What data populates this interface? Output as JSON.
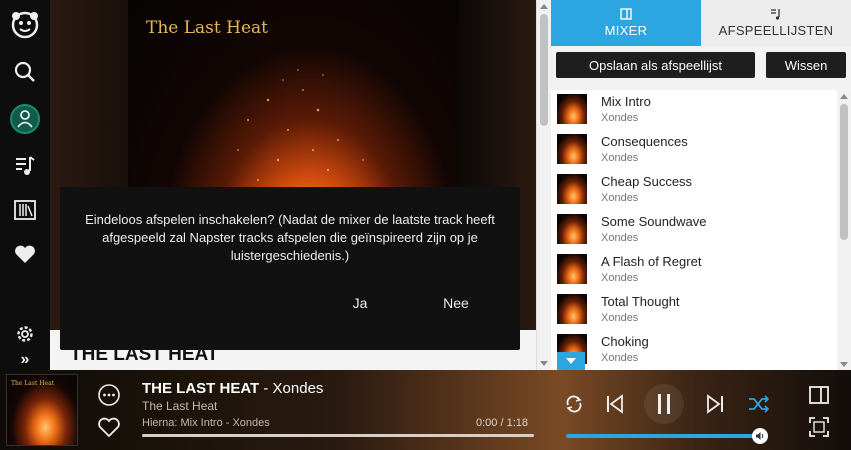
{
  "sidebar": {
    "items": [
      {
        "name": "napster-logo-icon"
      },
      {
        "name": "search-icon"
      },
      {
        "name": "profile-icon"
      },
      {
        "name": "playlist-music-icon"
      },
      {
        "name": "library-icon"
      },
      {
        "name": "favorites-heart-icon"
      },
      {
        "name": "settings-gear-icon"
      },
      {
        "name": "expand-chevrons-icon"
      }
    ],
    "expand_label": "»"
  },
  "main": {
    "album_art_text": "The Last Heat",
    "album_title": "THE LAST HEAT"
  },
  "dialog": {
    "message": "Eindeloos afspelen inschakelen? (Nadat de mixer de laatste track heeft afgespeeld zal Napster tracks afspelen die geïnspireerd zijn op je luistergeschiedenis.)",
    "yes_label": "Ja",
    "no_label": "Nee"
  },
  "right_panel": {
    "tabs": [
      {
        "label": "MIXER",
        "active": true
      },
      {
        "label": "AFSPEELLIJSTEN",
        "active": false
      }
    ],
    "save_label": "Opslaan als afspeellijst",
    "clear_label": "Wissen",
    "queue": [
      {
        "title": "Mix Intro",
        "artist": "Xondes"
      },
      {
        "title": "Consequences",
        "artist": "Xondes"
      },
      {
        "title": "Cheap Success",
        "artist": "Xondes"
      },
      {
        "title": "Some Soundwave",
        "artist": "Xondes"
      },
      {
        "title": "A Flash of Regret",
        "artist": "Xondes"
      },
      {
        "title": "Total Thought",
        "artist": "Xondes"
      },
      {
        "title": "Choking",
        "artist": "Xondes"
      }
    ]
  },
  "player": {
    "track_title": "THE LAST HEAT",
    "separator_artist": " - Xondes",
    "album": "The Last Heat",
    "up_next": "Hierna: Mix Intro - Xondes",
    "time": "0:00 / 1:18",
    "progress_fraction": 0.0,
    "volume_fraction": 1.0,
    "shuffle_active": true
  },
  "colors": {
    "accent": "#2ca6e0",
    "sidebar_bg": "#0d0d0d",
    "dialog_bg": "#111111",
    "avatar": "#0f5c4c"
  }
}
